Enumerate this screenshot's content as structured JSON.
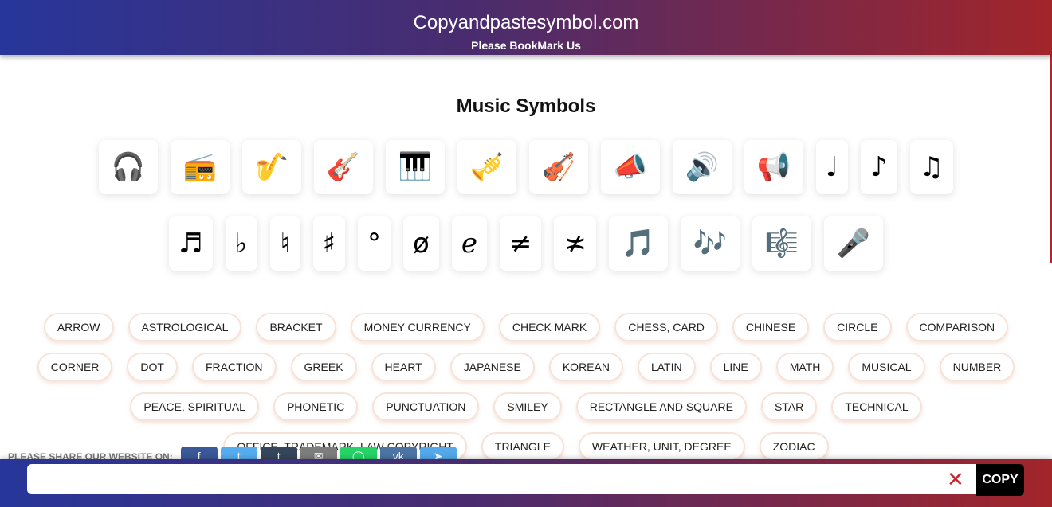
{
  "header": {
    "title": "Copyandpastesymbol.com",
    "subtitle": "Please BookMark Us"
  },
  "page_title": "Music Symbols",
  "symbols": [
    "🎧",
    "📻",
    "🎷",
    "🎸",
    "🎹",
    "🎺",
    "🎻",
    "📣",
    "🔊",
    "📢",
    "♩",
    "♪",
    "♫",
    "♬",
    "♭",
    "♮",
    "♯",
    "°",
    "ø",
    "ℯ",
    "≠",
    "≭",
    "🎵",
    "🎶",
    "🎼",
    "🎤"
  ],
  "categories": [
    "ARROW",
    "ASTROLOGICAL",
    "BRACKET",
    "MONEY CURRENCY",
    "CHECK MARK",
    "CHESS, CARD",
    "CHINESE",
    "CIRCLE",
    "COMPARISON",
    "CORNER",
    "DOT",
    "FRACTION",
    "GREEK",
    "HEART",
    "JAPANESE",
    "KOREAN",
    "LATIN",
    "LINE",
    "MATH",
    "MUSICAL",
    "NUMBER",
    "PEACE, SPIRITUAL",
    "PHONETIC",
    "PUNCTUATION",
    "SMILEY",
    "RECTANGLE AND SQUARE",
    "STAR",
    "TECHNICAL",
    "OFFICE, TRADEMARK, LAW COPYRIGHT",
    "TRIANGLE",
    "WEATHER, UNIT, DEGREE",
    "ZODIAC"
  ],
  "share": {
    "label": "PLEASE SHARE OUR WEBSITE ON:",
    "buttons": [
      {
        "name": "facebook",
        "glyph": "f",
        "color": "#3b5998"
      },
      {
        "name": "twitter",
        "glyph": "t",
        "color": "#55acee"
      },
      {
        "name": "tumblr",
        "glyph": "t",
        "color": "#35465c"
      },
      {
        "name": "email",
        "glyph": "✉",
        "color": "#7d7d7d"
      },
      {
        "name": "whatsapp",
        "glyph": "◯",
        "color": "#25d366"
      },
      {
        "name": "vk",
        "glyph": "vk",
        "color": "#4c75a3"
      },
      {
        "name": "telegram",
        "glyph": "➤",
        "color": "#54a9eb"
      }
    ]
  },
  "bottom": {
    "input_value": "",
    "clear_icon": "✕",
    "copy_label": "COPY"
  }
}
